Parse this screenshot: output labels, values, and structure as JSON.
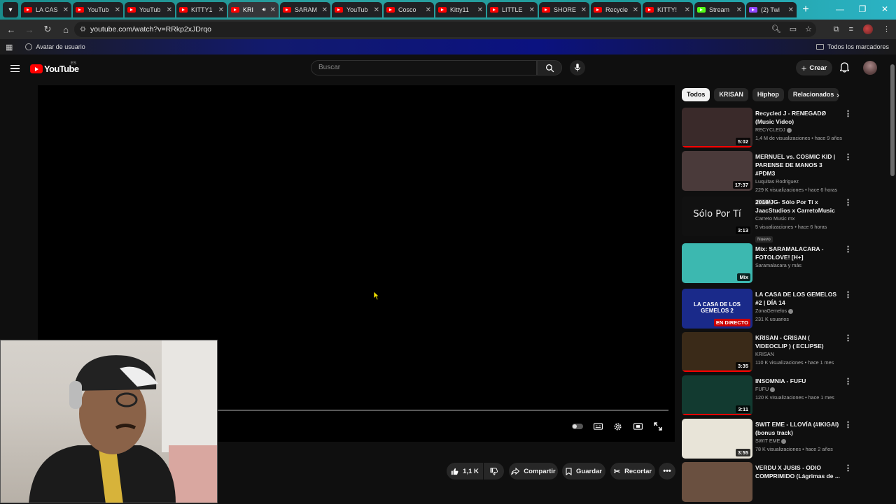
{
  "browser": {
    "tabs": [
      {
        "label": "LA CAS",
        "icon": "youtube",
        "active": false
      },
      {
        "label": "YouTub",
        "icon": "youtube",
        "active": false
      },
      {
        "label": "YouTub",
        "icon": "youtube",
        "active": false
      },
      {
        "label": "KITTY1",
        "icon": "youtube",
        "active": false
      },
      {
        "label": "KRI",
        "icon": "youtube",
        "active": true,
        "audio": true
      },
      {
        "label": "SARAM",
        "icon": "youtube",
        "active": false
      },
      {
        "label": "YouTub",
        "icon": "youtube",
        "active": false
      },
      {
        "label": "Cosco",
        "icon": "youtube",
        "active": false
      },
      {
        "label": "Kitty11",
        "icon": "youtube",
        "active": false
      },
      {
        "label": "LITTLE",
        "icon": "youtube",
        "active": false
      },
      {
        "label": "SHORE",
        "icon": "youtube",
        "active": false
      },
      {
        "label": "Recycle",
        "icon": "youtube",
        "active": false
      },
      {
        "label": "KITTY!",
        "icon": "youtube",
        "active": false
      },
      {
        "label": "Stream",
        "icon": "kick",
        "active": false
      },
      {
        "label": "(2) Twi",
        "icon": "twitch",
        "active": false
      }
    ],
    "url": "youtube.com/watch?v=RRkp2xJDrqo",
    "bookmark_item": "Avatar de usuario",
    "all_bookmarks": "Todos los marcadores"
  },
  "youtube": {
    "logo_text": "YouTube",
    "country_code": "ES",
    "search_placeholder": "Buscar",
    "create_label": "Crear",
    "actions": {
      "likes": "1,1 K",
      "share": "Compartir",
      "save": "Guardar",
      "clip": "Recortar"
    },
    "chips": [
      "Todos",
      "KRISAN",
      "Hiphop",
      "Relacionados"
    ],
    "recommendations": [
      {
        "title": "Recycled J - RENEGADØ (Music Video)",
        "channel": "RECYCLEDJ",
        "verified": true,
        "stats": "1,4 M de visualizaciones • hace 9 años",
        "badge": "",
        "duration": "5:02",
        "thumb_color": "#3a2a2a",
        "watched": true
      },
      {
        "title": "MERNUEL vs. COSMIC KID | PARENSE DE MANOS 3 #PDM3",
        "channel": "Luquitas Rodriguez",
        "verified": false,
        "stats": "229 K visualizaciones • hace 6 horas",
        "badge": "Nuevo",
        "duration": "17:37",
        "thumb_color": "#4a3a3a",
        "watched": false
      },
      {
        "title": "2018/JG- Sólo Por Tí x JaacStudios x CarretoMusic",
        "channel": "Carreto Music mx",
        "verified": false,
        "stats": "5 visualizaciones • hace 6 horas",
        "badge": "Nuevo",
        "duration": "3:13",
        "thumb_color": "#111111",
        "thumb_text": "Sólo Por Tí",
        "watched": false
      },
      {
        "title": "Mix: SARAMALACARA - FOTOLOVE! [H+]",
        "channel": "Saramalacara y más",
        "verified": false,
        "stats": "",
        "badge": "",
        "duration": "Mix",
        "thumb_color": "#3cb8b0",
        "watched": false
      },
      {
        "title": "LA CASA DE LOS GEMELOS #2 | DÍA 14",
        "channel": "ZonaGemelos",
        "verified": true,
        "stats": "231 K usuarios",
        "badge": "",
        "duration": "EN DIRECTO",
        "live": true,
        "thumb_color": "#1a2a8a",
        "thumb_text": "LA CASA DE LOS GEMELOS 2",
        "watched": false
      },
      {
        "title": "KRISAN - CRISAN ( VIDEOCLIP ) ( ECLIPSE)",
        "channel": "KRISAN",
        "verified": false,
        "stats": "110 K visualizaciones • hace 1 mes",
        "badge": "",
        "duration": "3:35",
        "thumb_color": "#3a2a18",
        "watched": true
      },
      {
        "title": "INSOMNIA - FUFU",
        "channel": "FUFU",
        "verified": true,
        "stats": "120 K visualizaciones • hace 1 mes",
        "badge": "",
        "duration": "3:11",
        "thumb_color": "#123a30",
        "watched": true
      },
      {
        "title": "SWIT EME - LLOVÍA (#IKIGAI) (bonus track)",
        "channel": "SWIT EME",
        "verified": true,
        "stats": "78 K visualizaciones • hace 2 años",
        "badge": "",
        "duration": "3:55",
        "thumb_color": "#e8e4d8",
        "watched": false
      },
      {
        "title": "VERDU X JUSIS - ODIO COMPRIMIDO (Lágrimas de ...",
        "channel": "",
        "verified": false,
        "stats": "",
        "badge": "",
        "duration": "",
        "thumb_color": "#6a5040",
        "watched": false
      }
    ]
  }
}
